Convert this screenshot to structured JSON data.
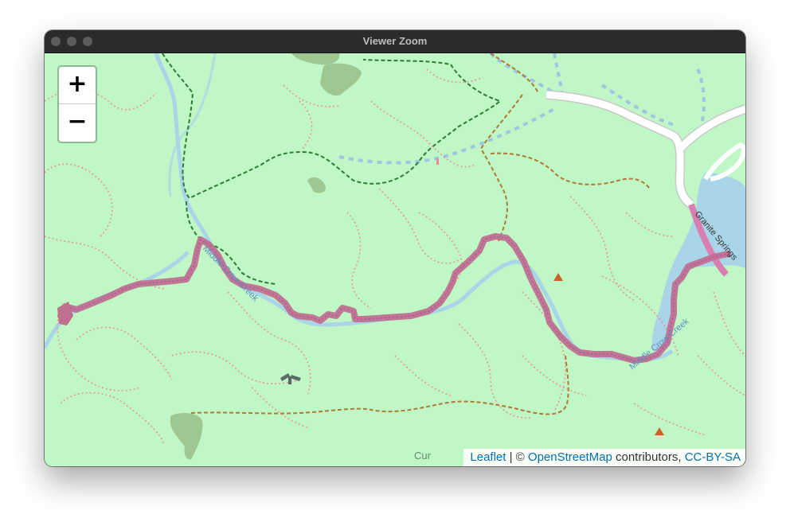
{
  "window": {
    "title": "Viewer Zoom"
  },
  "zoom": {
    "in_label": "+",
    "out_label": "−"
  },
  "attribution": {
    "leaflet": "Leaflet",
    "sep": " | © ",
    "osm": "OpenStreetMap",
    "contributors": " contributors, ",
    "license": "CC-BY-SA"
  },
  "map": {
    "labels": {
      "creek_1": "Middle Crow Creek",
      "creek_2": "Middle Crow Creek",
      "road": "Granite Springs",
      "area": "Cur"
    },
    "colors": {
      "land": "#bff7c6",
      "track": "#c0708f",
      "water": "#a8d5e8",
      "path": "#f08b8b",
      "trail_green": "#2e7d32",
      "trail_brown": "#b07a30",
      "road": "#ffffff"
    },
    "icons": [
      "mountain-peak-icon",
      "picnic-icon"
    ]
  }
}
